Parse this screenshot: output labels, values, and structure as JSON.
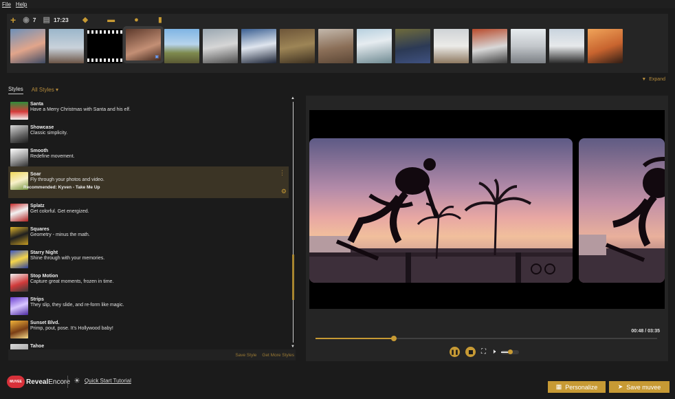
{
  "menu": {
    "file": "File",
    "help": "Help"
  },
  "media": {
    "photo_count": "7",
    "video_duration": "17:23",
    "expand_label": "Expand",
    "thumbs": [
      {
        "bg": "linear-gradient(160deg,#6d90b9,#e1a58b 55%,#3d4a63)"
      },
      {
        "bg": "linear-gradient(180deg,#9bb6cb,#c9d2da 55%,#6c5546)"
      },
      {
        "bg": "film"
      },
      {
        "bg": "linear-gradient(160deg,#5d3a2c,#c38f75 60%,#42291f)",
        "selected": true
      },
      {
        "bg": "linear-gradient(180deg,#7fb4e4,#b7d4ec 45%,#7e8a4e 70%,#5a5933)"
      },
      {
        "bg": "linear-gradient(170deg,#9aa7b1,#d6d6d6 50%,#4e4e4e)"
      },
      {
        "bg": "linear-gradient(170deg,#3a5f92,#dfe5ee 50%,#1c2436)"
      },
      {
        "bg": "linear-gradient(170deg,#6e5639,#9d8556 50%,#3d3020)"
      },
      {
        "bg": "linear-gradient(170deg,#c3b8ac,#8b6f58 55%,#5c4736)"
      },
      {
        "bg": "linear-gradient(170deg,#b7d0df,#e6ecf0 40%,#6f8a92)"
      },
      {
        "bg": "linear-gradient(170deg,#6f6b3b,#2c3a55 55%,#3f5180)"
      },
      {
        "bg": "linear-gradient(180deg,#cfd3d6,#ecebe8 50%,#8d7961)"
      },
      {
        "bg": "linear-gradient(170deg,#b84a2b,#d8d8d8 55%,#3d3d3d)"
      },
      {
        "bg": "linear-gradient(180deg,#e7ecef,#c3c7cb 50%,#7b7f84)"
      },
      {
        "bg": "linear-gradient(180deg,#c9d4de,#e7e9eb 50%,#2a2a2a)"
      },
      {
        "bg": "linear-gradient(160deg,#f0a45a,#c8642f 55%,#2f1d15)"
      }
    ]
  },
  "styles_tabs": {
    "active": "Styles",
    "filter": "All Styles"
  },
  "styles": [
    {
      "name": "Santa",
      "desc": "Have a Merry Christmas with Santa and his elf.",
      "icon": "linear-gradient(180deg,#2f8d3a,#d63b3b 55%,#f3f3f3)"
    },
    {
      "name": "Showcase",
      "desc": "Classic simplicity.",
      "icon": "linear-gradient(160deg,#d7d7d7,#5e5e5e 60%,#1b1b1b)"
    },
    {
      "name": "Smooth",
      "desc": "Redefine movement.",
      "icon": "linear-gradient(160deg,#ffffff,#9a9a9a 55%,#2f2f2f)"
    },
    {
      "name": "Soar",
      "desc": "Fly through your photos and video.",
      "icon": "linear-gradient(160deg,#f0d85a,#f7f0c9 50%,#6e8e3a)",
      "selected": true,
      "recommended": "Recommended: Kyven - Take Me Up"
    },
    {
      "name": "Splatz",
      "desc": "Get colorful. Get energized.",
      "icon": "linear-gradient(160deg,#c72a2a,#f2f2f2 45%,#b02020)"
    },
    {
      "name": "Squares",
      "desc": "Geometry - minus the math.",
      "icon": "linear-gradient(160deg,#e0b42c,#1f1f1f 50%,#c89d23)"
    },
    {
      "name": "Starry Night",
      "desc": "Shine through with your memories.",
      "icon": "linear-gradient(160deg,#3a55c4,#f5d54a 50%,#2c3f9b)"
    },
    {
      "name": "Stop Motion",
      "desc": "Capture great moments, frozen in time.",
      "icon": "linear-gradient(160deg,#f2f2f2,#d03a3a 55%,#3a3a3a)"
    },
    {
      "name": "Strips",
      "desc": "They slip, they slide, and re-form like magic.",
      "icon": "linear-gradient(160deg,#6a3ed0,#d8c6ff 50%,#4b2aa0)"
    },
    {
      "name": "Sunset Blvd.",
      "desc": "Primp, pout, pose. It's Hollywood baby!",
      "icon": "linear-gradient(160deg,#f0b23a,#7a3e16 55%,#f7dc8a)"
    },
    {
      "name": "Tahoe",
      "desc": "",
      "icon": "linear-gradient(160deg,#d9d9d9,#7d7d7d)"
    }
  ],
  "styles_footer": {
    "save_style": "Save Style",
    "get_more": "Get More Styles"
  },
  "player": {
    "time": "00:48 / 03:35",
    "progress": 0.23,
    "volume": 0.5
  },
  "bottom": {
    "logo_badge": "MUVEE",
    "logo_reveal": "Reveal",
    "logo_encore": "Encore",
    "tutorial": "Quick Start Tutorial",
    "personalize": "Personalize",
    "save": "Save muvee"
  },
  "colors": {
    "accent": "#c79a34",
    "background": "#1b1b1b",
    "panel": "#252525"
  }
}
